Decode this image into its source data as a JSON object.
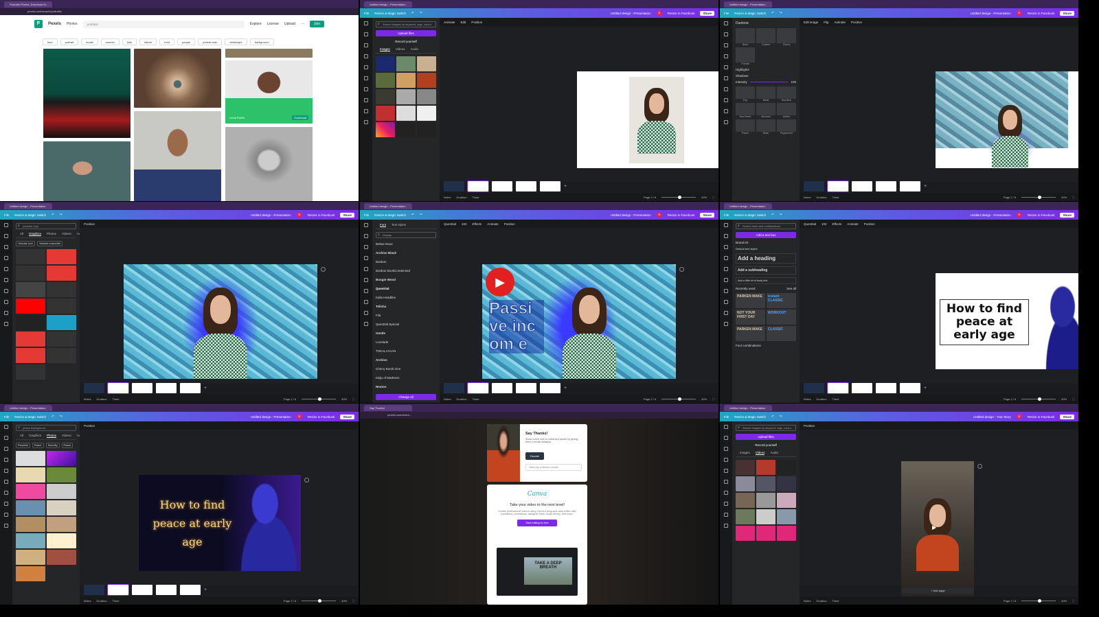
{
  "panel1": {
    "tab_title": "Portraits Photos, Download Fr...",
    "url": "pexels.com/search/portraits/",
    "logo": "Pexels",
    "search_type": "Photos",
    "search_value": "portraits",
    "nav": [
      "Explore",
      "License",
      "Upload",
      "···"
    ],
    "join": "Join",
    "tags": [
      "face",
      "portrait",
      "model",
      "woman",
      "kids",
      "nature",
      "food",
      "people",
      "portrait man",
      "landscape",
      "background"
    ],
    "photographer": "Linda Roelfs",
    "download": "Download"
  },
  "canva_common": {
    "file": "File",
    "resize": "Resize & Magic Switch",
    "title": "Untitled design - Presentation",
    "resize_to": "Resize to Facebook",
    "share": "Share",
    "avatar": "S",
    "notes": "Notes",
    "duration": "Duration",
    "timer": "Timer",
    "page": "Page 2 / 5",
    "zoom": "49%"
  },
  "panel2": {
    "search_placeholder": "Search images by keyword, tags, colour",
    "upload": "Upload files",
    "record": "Record yourself",
    "tabs": [
      "Images",
      "Videos",
      "Audio"
    ],
    "toolbar": [
      "Animate",
      "Edit",
      "Position"
    ]
  },
  "panel3": {
    "back": "Duotone",
    "labels": [
      "None",
      "Custom",
      "Cherry",
      "Portrait"
    ],
    "highlights": "Highlights",
    "shadows": "Shadows",
    "intensity": "Intensity",
    "intensity_value": "100",
    "labels2": [
      "Pop",
      "Metal",
      "Sea Blue",
      "Sea Green",
      "Moonset",
      "Amber",
      "Peach",
      "Blush",
      "Peppermint"
    ],
    "toolbar": [
      "Edit image",
      "Flip",
      "Animate",
      "Position"
    ]
  },
  "panel4": {
    "search_value": "youtube logo",
    "tabs": [
      "All",
      "Graphics",
      "Photos",
      "Videos",
      "Audio"
    ],
    "chips": [
      "Youtube icon",
      "Youtube subscribe"
    ],
    "toolbar": [
      "Position"
    ]
  },
  "panel5": {
    "tabs": [
      "Font",
      "Text styles"
    ],
    "search": "Display",
    "fonts": [
      "Bebas Neue",
      "Archivo Black",
      "Bonbon",
      "Bonbon BookCondensed",
      "Boogie Wood",
      "Questrial",
      "Kalia Headline",
      "Telisha",
      "Fila",
      "Questrial Special",
      "Gentle",
      "Lovelade",
      "TOKALAYAAN",
      "Archivo",
      "Cherry Bomb One",
      "Kaiju of Madness",
      "Neuton"
    ],
    "apply": "Change all",
    "toolbar": [
      "Questrial",
      "102",
      "Effects",
      "Animate",
      "Position"
    ],
    "slide_text": "Passi ve incom e"
  },
  "panel6": {
    "search_placeholder": "Search fonts and combinations",
    "add_text": "Add a text box",
    "brand_kit": "Brand Kit",
    "default_styles": "Default text styles",
    "heading": "Add a heading",
    "subheading": "Add a subheading",
    "body": "Add a little bit of body text",
    "recent": "Recently used",
    "see_all": "See all",
    "combos": "Font combinations",
    "samples": [
      "PARKEN MAKE",
      "instant CLASSIC",
      "NOT YOUR FIRST DAY",
      "WORKOUT",
      "PARKEN MAKE",
      "CLASSIC"
    ],
    "toolbar": [
      "Questrial",
      "102",
      "Effects",
      "Animate",
      "Position"
    ],
    "slide_text": "How to find peace at early age"
  },
  "panel7": {
    "search_value": "peace background",
    "tabs": [
      "All",
      "Graphics",
      "Photos",
      "Videos",
      "Audio"
    ],
    "chips": [
      "Peaceful",
      "Peace",
      "Serenity",
      "Peace"
    ],
    "toolbar": [
      "Position"
    ],
    "slide_text": "How to find peace at early age"
  },
  "panel8": {
    "url": "pexels.com/video/...",
    "say_thanks": "Say Thanks!",
    "donate_text": "Show some love to cottonbro studio by giving them a small donation.",
    "donate": "Donate",
    "credit": "Video by cottonbro studio",
    "canva_logo": "Canva",
    "promo_title": "Take your video to the next level!",
    "promo_text": "Create professional videos using Canva's drag-and-drop editor with transitions, animations, designer fonts, audio library, and more.",
    "promo_button": "Start editing for free",
    "promo_image_text": "TAKE A DEEP BREATH"
  },
  "panel9": {
    "search_placeholder": "Search images by keyword, tags, colour",
    "upload": "Upload files",
    "record": "Record yourself",
    "tabs": [
      "Images",
      "Videos",
      "Audio"
    ],
    "toolbar": [
      "Position"
    ],
    "add_page": "+ Add page",
    "title": "Untitled design - Your Story",
    "page": "Page 2 / 5"
  },
  "colors": {
    "canva_purple": "#7d2ae8",
    "pexels_green": "#05a081",
    "canva_dark": "#18191b"
  }
}
